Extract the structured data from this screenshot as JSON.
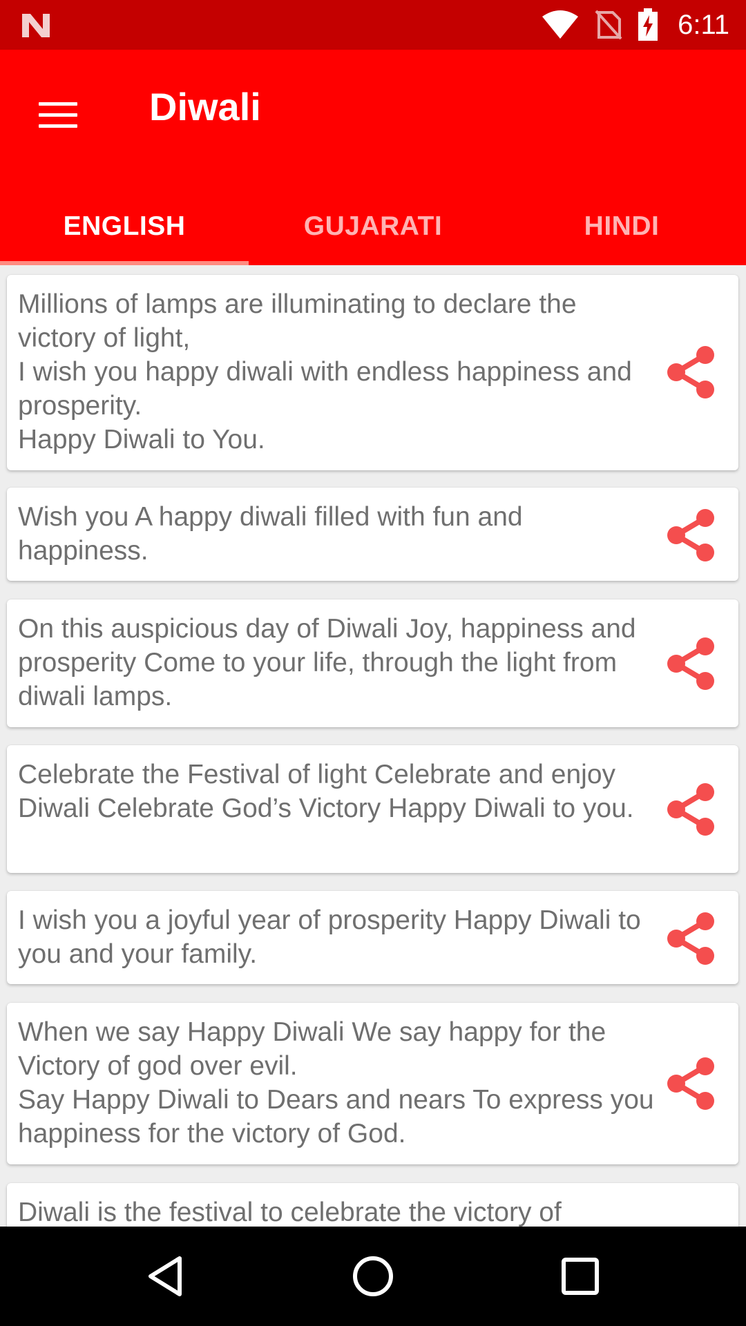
{
  "status_bar": {
    "time": "6:11",
    "icons": [
      "notification-n-icon",
      "wifi-icon",
      "no-sim-icon",
      "battery-charging-icon"
    ]
  },
  "app_bar": {
    "title": "Diwali",
    "menu_icon": "hamburger-menu-icon",
    "background_color": "#ff0000"
  },
  "tabs": [
    {
      "label": "ENGLISH",
      "active": true
    },
    {
      "label": "GUJARATI",
      "active": false
    },
    {
      "label": "HINDI",
      "active": false
    }
  ],
  "messages": [
    {
      "text": "Millions of lamps are illuminating to declare the victory of light,\nI wish you happy diwali with endless happiness and prosperity.\nHappy Diwali to You."
    },
    {
      "text": "Wish you A happy diwali filled with fun and happiness."
    },
    {
      "text": "On this auspicious day of Diwali Joy, happiness and prosperity Come to your life, through the light from diwali lamps."
    },
    {
      "text": "Celebrate the Festival of light Celebrate and enjoy Diwali Celebrate God’s Victory Happy Diwali to you."
    },
    {
      "text": "I wish you a joyful year of prosperity Happy Diwali to you and your family."
    },
    {
      "text": "When we say Happy Diwali We say happy for the Victory of god over evil.\nSay Happy Diwali to Dears and nears To express you happiness for the victory of God."
    },
    {
      "text": "Diwali is the festival to celebrate the victory of"
    }
  ],
  "share_icon": "share-icon",
  "share_color": "#f44e4e",
  "nav_bar": {
    "icons": [
      "back-icon",
      "home-icon",
      "recents-icon"
    ]
  }
}
